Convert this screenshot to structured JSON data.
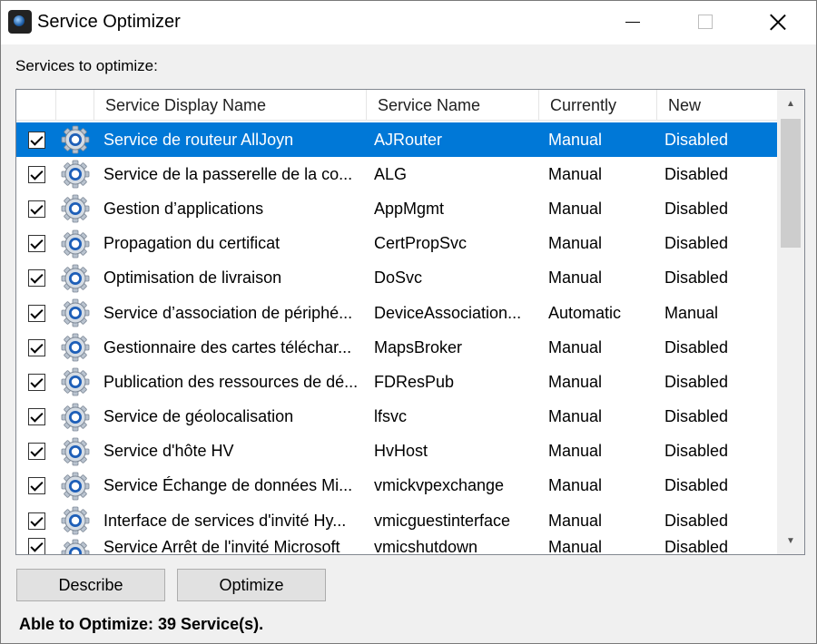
{
  "window": {
    "title": "Service Optimizer",
    "controls": {
      "minimize": "minimize",
      "maximize": "maximize",
      "close": "close"
    }
  },
  "section_label": "Services to optimize:",
  "listview": {
    "columns": [
      "",
      "",
      "Service Display Name",
      "Service Name",
      "Currently",
      "New"
    ],
    "rows": [
      {
        "checked": true,
        "display": "Service de routeur AllJoyn",
        "service": "AJRouter",
        "currently": "Manual",
        "new": "Disabled",
        "selected": true
      },
      {
        "checked": true,
        "display": "Service de la passerelle de la co...",
        "service": "ALG",
        "currently": "Manual",
        "new": "Disabled"
      },
      {
        "checked": true,
        "display": "Gestion d’applications",
        "service": "AppMgmt",
        "currently": "Manual",
        "new": "Disabled"
      },
      {
        "checked": true,
        "display": "Propagation du certificat",
        "service": "CertPropSvc",
        "currently": "Manual",
        "new": "Disabled"
      },
      {
        "checked": true,
        "display": "Optimisation de livraison",
        "service": "DoSvc",
        "currently": "Manual",
        "new": "Disabled"
      },
      {
        "checked": true,
        "display": "Service d’association de périphé...",
        "service": "DeviceAssociation...",
        "currently": "Automatic",
        "new": "Manual"
      },
      {
        "checked": true,
        "display": "Gestionnaire des cartes téléchar...",
        "service": "MapsBroker",
        "currently": "Manual",
        "new": "Disabled"
      },
      {
        "checked": true,
        "display": "Publication des ressources de dé...",
        "service": "FDResPub",
        "currently": "Manual",
        "new": "Disabled"
      },
      {
        "checked": true,
        "display": "Service de géolocalisation",
        "service": "lfsvc",
        "currently": "Manual",
        "new": "Disabled"
      },
      {
        "checked": true,
        "display": "Service d'hôte HV",
        "service": "HvHost",
        "currently": "Manual",
        "new": "Disabled"
      },
      {
        "checked": true,
        "display": "Service Échange de données Mi...",
        "service": "vmickvpexchange",
        "currently": "Manual",
        "new": "Disabled"
      },
      {
        "checked": true,
        "display": "Interface de services d'invité Hy...",
        "service": "vmicguestinterface",
        "currently": "Manual",
        "new": "Disabled"
      },
      {
        "checked": true,
        "display": "Service Arrêt de l'invité Microsoft",
        "service": "vmicshutdown",
        "currently": "Manual",
        "new": "Disabled"
      }
    ],
    "scrollbar": {
      "up": "▲",
      "down": "▼"
    }
  },
  "buttons": {
    "describe": "Describe",
    "optimize": "Optimize"
  },
  "status": "Able to Optimize: 39 Service(s).",
  "colors": {
    "selection": "#0078d7",
    "window_bg": "#f0f0f0"
  }
}
